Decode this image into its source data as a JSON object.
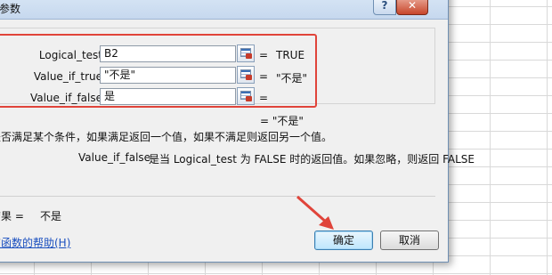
{
  "window": {
    "title": "参数",
    "close_icon": "close-icon",
    "help_icon": "question-mark-icon"
  },
  "args": [
    {
      "label": "Logical_test",
      "value": "B2",
      "result": "TRUE"
    },
    {
      "label": "Value_if_true",
      "value": "\"不是\"",
      "result": "\"不是\""
    },
    {
      "label": "Value_if_false",
      "value": "是",
      "result": ""
    }
  ],
  "equals_sign": "=",
  "formula_result_preview": "= \"不是\"",
  "description": "是否满足某个条件，如果满足返回一个值，如果不满足则返回另一个值。",
  "param_help": {
    "name": "Value_if_false",
    "text": "是当 Logical_test 为 FALSE 时的返回值。如果忽略，则返回 FALSE"
  },
  "calc_result": {
    "label": "结果 =",
    "value": "不是"
  },
  "help_link": "该函数的帮助(H)",
  "buttons": {
    "ok": "确定",
    "cancel": "取消"
  },
  "colors": {
    "annotation": "#e0443a",
    "link": "#1a4fbf"
  }
}
